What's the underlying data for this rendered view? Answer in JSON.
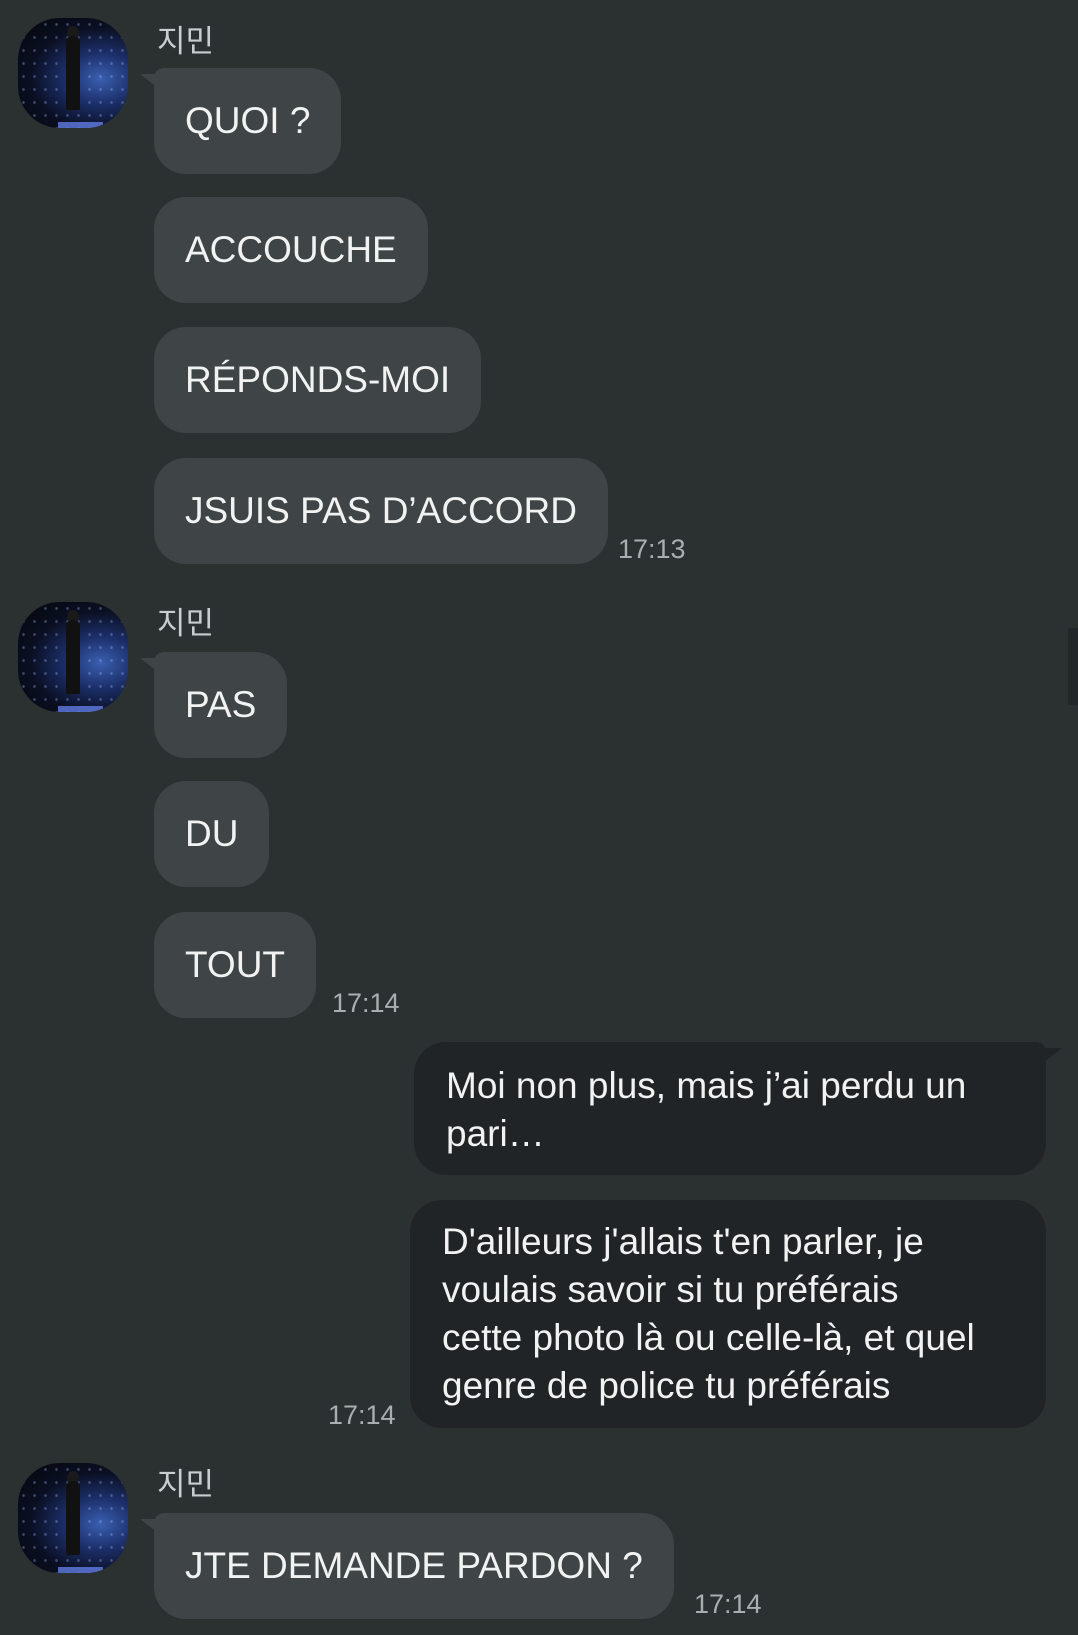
{
  "contact_name": "지민",
  "groups": [
    {
      "messages": [
        "QUOI ?",
        "ACCOUCHE",
        "RÉPONDS-MOI",
        "JSUIS PAS D’ACCORD"
      ],
      "time": "17:13"
    },
    {
      "messages": [
        "PAS",
        "DU",
        "TOUT"
      ],
      "time": "17:14"
    },
    {
      "mine": true,
      "messages": [
        "Moi non plus, mais j’ai perdu un pari…",
        "D'ailleurs j'allais t'en parler, je voulais savoir si tu préférais cette photo là ou celle-là, et quel genre de police tu préférais"
      ],
      "time": "17:14"
    },
    {
      "messages": [
        "JTE DEMANDE PARDON ?"
      ],
      "time": "17:14"
    }
  ],
  "mine_lines": {
    "m1": [
      "Moi non plus, mais j’ai perdu un",
      "pari…"
    ],
    "m2": [
      "D'ailleurs j'allais t'en parler, je",
      "voulais savoir si tu préférais",
      "cette photo là ou celle-là, et quel",
      "genre de police tu préférais"
    ]
  }
}
